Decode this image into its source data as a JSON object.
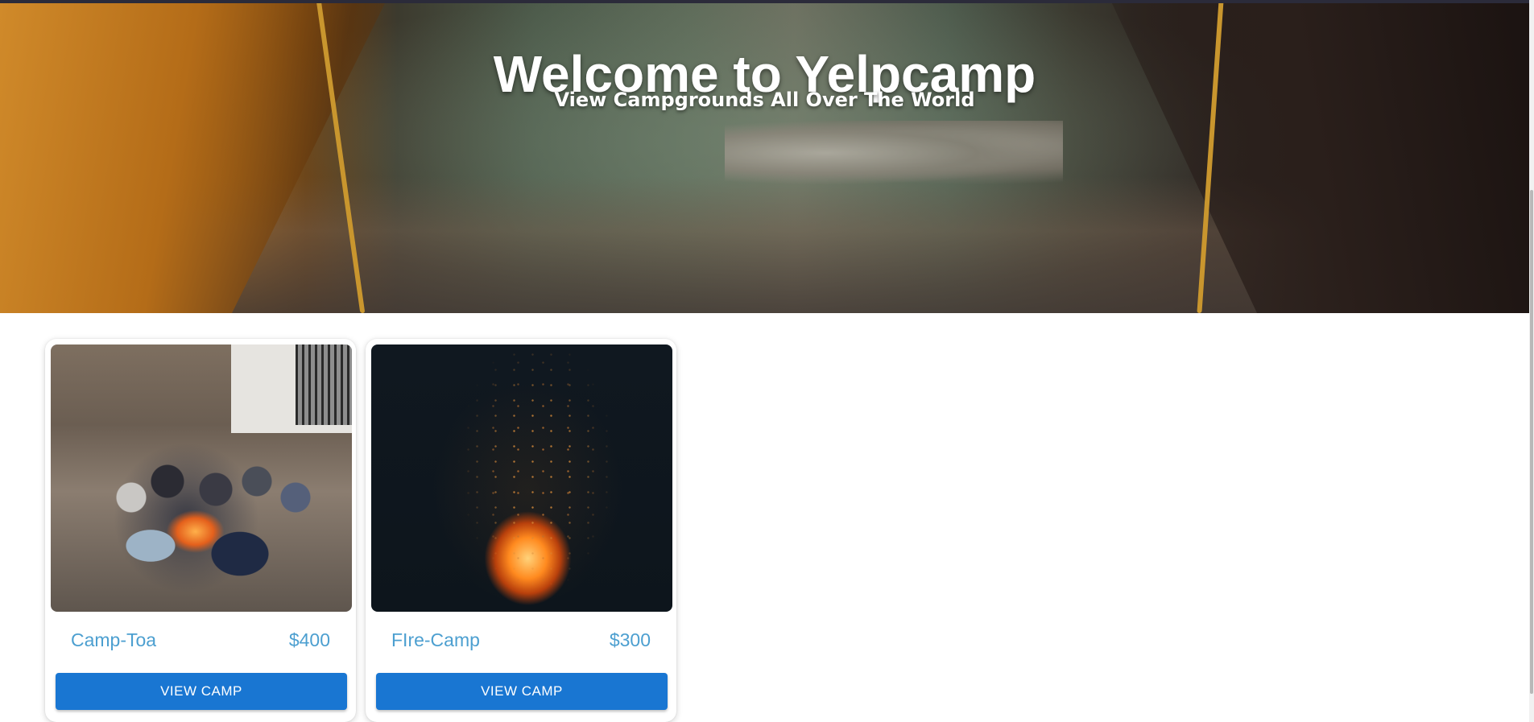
{
  "hero": {
    "title": "Welcome to Yelpcamp",
    "subtitle": "View Campgrounds All Over The World"
  },
  "campgrounds": [
    {
      "name": "Camp-Toa",
      "price": "$400",
      "button_label": "VIEW CAMP"
    },
    {
      "name": "FIre-Camp",
      "price": "$300",
      "button_label": "VIEW CAMP"
    }
  ],
  "colors": {
    "accent": "#1976d2",
    "link_text": "#4c9fd0"
  }
}
